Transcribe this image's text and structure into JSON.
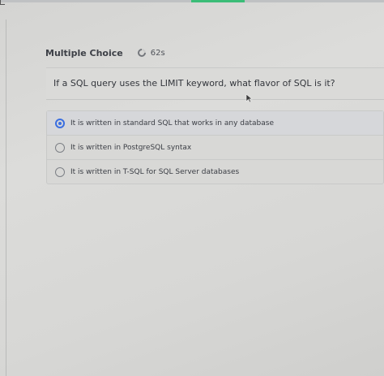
{
  "header": {
    "title": "Multiple Choice",
    "timer": "62s"
  },
  "question": {
    "text": "If a SQL query uses the LIMIT keyword, what flavor of SQL is it?"
  },
  "options": [
    {
      "label": "It is written in standard SQL that works in any database",
      "selected": true
    },
    {
      "label": "It is written in PostgreSQL syntax",
      "selected": false
    },
    {
      "label": "It is written in T-SQL for SQL Server databases",
      "selected": false
    }
  ],
  "colors": {
    "progress": "#3bbd78",
    "radio_selected": "#3b6fe0"
  },
  "icons": [
    "timer-icon",
    "mouse-cursor-icon"
  ]
}
